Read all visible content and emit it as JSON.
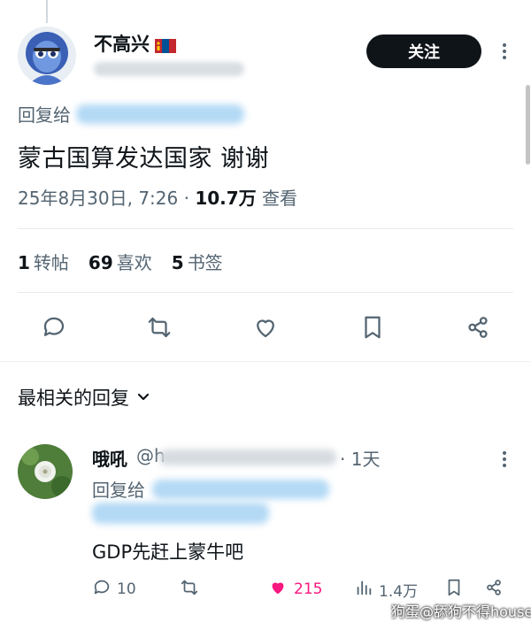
{
  "post": {
    "display_name": "不高兴",
    "follow_label": "关注",
    "reply_to_label": "回复给",
    "text": "蒙古国算发达国家 谢谢",
    "timestamp": "25年8月30日, 7:26",
    "views_value": "10.7万",
    "views_label": "查看",
    "stats": {
      "reposts_count": "1",
      "reposts_label": "转帖",
      "likes_count": "69",
      "likes_label": "喜欢",
      "bookmarks_count": "5",
      "bookmarks_label": "书签"
    }
  },
  "replies_section": {
    "sort_label": "最相关的回复"
  },
  "reply": {
    "display_name": "哦吼",
    "handle_prefix": "@h",
    "time": "· 1天",
    "reply_to_label": "回复给",
    "text": "GDP先赶上蒙牛吧",
    "comments": "10",
    "likes": "215",
    "views": "1.4万"
  },
  "watermark": "狗蛋@舔狗不得house",
  "colors": {
    "text": "#0f1419",
    "secondary": "#536471",
    "like_pink": "#f91880",
    "follow_bg": "#0f1419"
  },
  "icons": [
    "reply-icon",
    "repost-icon",
    "like-icon",
    "bookmark-icon",
    "share-icon",
    "more-icon",
    "chevron-down-icon",
    "views-icon"
  ]
}
